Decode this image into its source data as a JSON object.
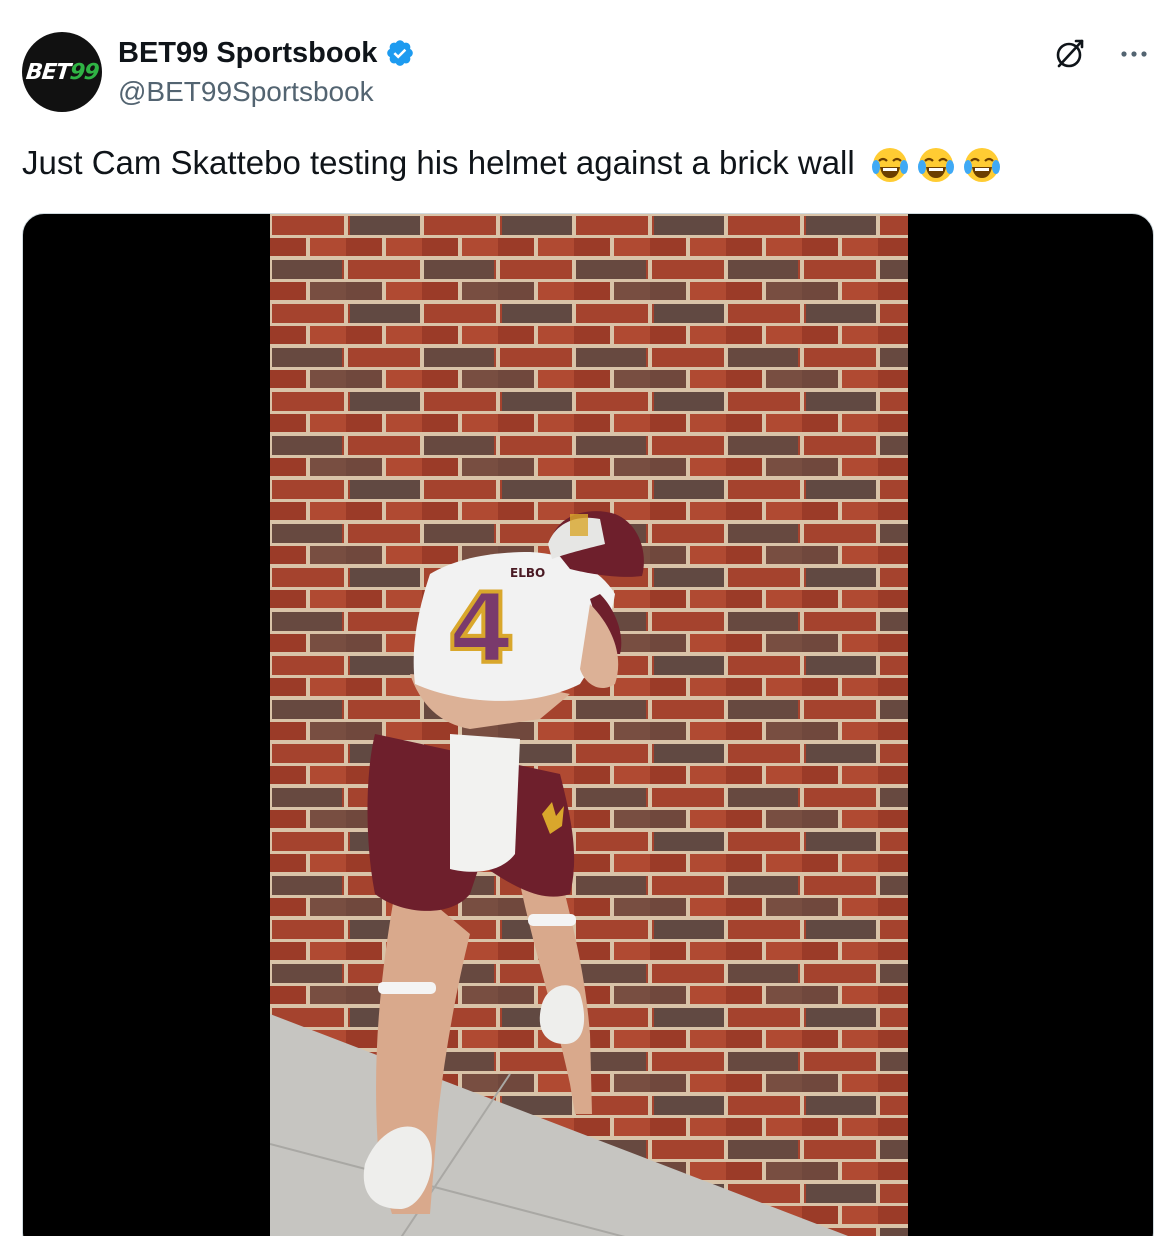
{
  "author": {
    "display_name": "BET99 Sportsbook",
    "handle": "@BET99Sportsbook",
    "verified": true,
    "avatar_logo_text": "BET",
    "avatar_logo_number": "99"
  },
  "tweet": {
    "text": "Just Cam Skattebo testing his helmet against a brick wall",
    "emojis": [
      "face-with-tears-of-joy",
      "face-with-tears-of-joy",
      "face-with-tears-of-joy"
    ]
  },
  "media": {
    "type": "video",
    "jersey_number": "4",
    "jersey_name_partial": "ELBO"
  },
  "colors": {
    "verified_blue": "#1d9bf0",
    "text_primary": "#0f1419",
    "text_secondary": "#536471",
    "brand_green": "#2fb344",
    "maroon": "#6e1f2c",
    "gold": "#d9a72c"
  },
  "icons": {
    "grok": "grok-icon",
    "more": "more-icon",
    "verified": "verified-badge-icon"
  }
}
